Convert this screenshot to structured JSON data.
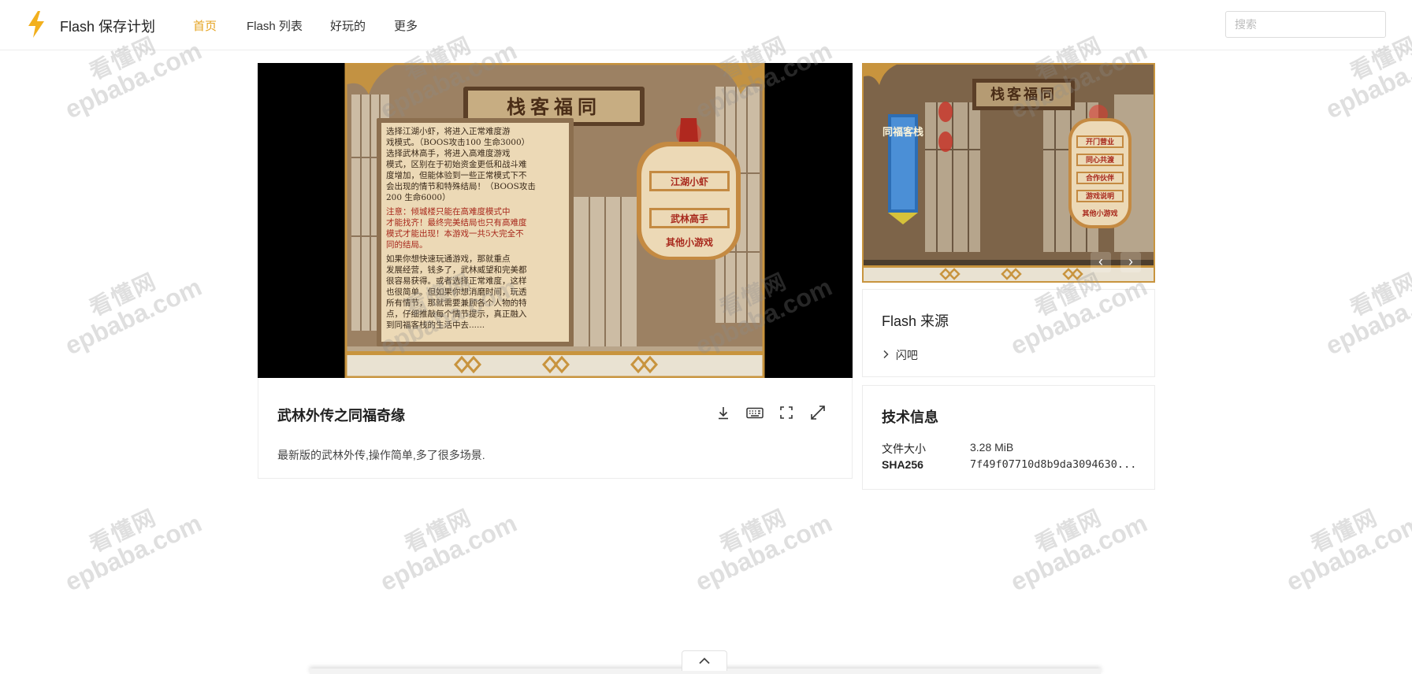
{
  "header": {
    "site_title": "Flash 保存计划",
    "nav": [
      {
        "label": "首页",
        "active": true
      },
      {
        "label": "Flash 列表",
        "active": false
      },
      {
        "label": "好玩的",
        "active": false
      },
      {
        "label": "更多",
        "active": false
      }
    ],
    "search_placeholder": "搜索"
  },
  "player": {
    "screen": {
      "signboard": "栈客福同",
      "intro_lines": [
        "选择江湖小虾，将进入正常难度游",
        "戏模式。（BOOS攻击100 生命3000）",
        "选择武林高手，将进入高难度游戏",
        "模式，区别在于初始资金更低和战斗难",
        "度增加，但能体验到一些正常模式下不",
        "会出现的情节和特殊结局！（BOOS攻击",
        "200 生命6000）",
        "注意：倾城楼只能在高难度模式中",
        "才能找齐！最终完美结局也只有高难度",
        "模式才能出现！本游戏一共5大完全不",
        "同的结局。",
        "如果你想快速玩通游戏，那就重点",
        "发展经营，钱多了，武林威望和完美都",
        "很容易获得。或者选择正常难度，这样",
        "也很简单。但如果你想消磨时间，玩透",
        "所有情节，那就需要兼顾各个人物的特",
        "点，仔细推敲每个情节提示，真正融入",
        "到同福客栈的生活中去......"
      ],
      "option_easy": "江湖小虾",
      "option_hard": "武林高手",
      "option_more": "其他小游戏"
    }
  },
  "game": {
    "title": "武林外传之同福奇缘",
    "description": "最新版的武林外传,操作简单,多了很多场景.",
    "tools": [
      "download-icon",
      "keyboard-icon",
      "fullscreen-icon",
      "expand-icon"
    ]
  },
  "gallery": {
    "signboard": "栈客福同",
    "banner": "同福客栈",
    "menu": [
      "开门营业",
      "同心共渡",
      "合作伙伴",
      "游戏说明",
      "其他小游戏"
    ],
    "prev": "‹",
    "next": "›"
  },
  "source_card": {
    "title": "Flash 来源",
    "link": "闪吧"
  },
  "tech_card": {
    "title": "技术信息",
    "rows": [
      {
        "label": "文件大小",
        "value": "3.28 MiB"
      },
      {
        "label": "SHA256",
        "value": "7f49f07710d8b9da3094630..."
      }
    ]
  },
  "watermark": {
    "cn": "看懂网",
    "en": "epbaba.com"
  },
  "colors": {
    "accent": "#e5a321",
    "player_bg": "#000000",
    "parchment": "#e9d3ac",
    "wood": "#8a6a4a",
    "frame_gold": "#c8943e"
  }
}
